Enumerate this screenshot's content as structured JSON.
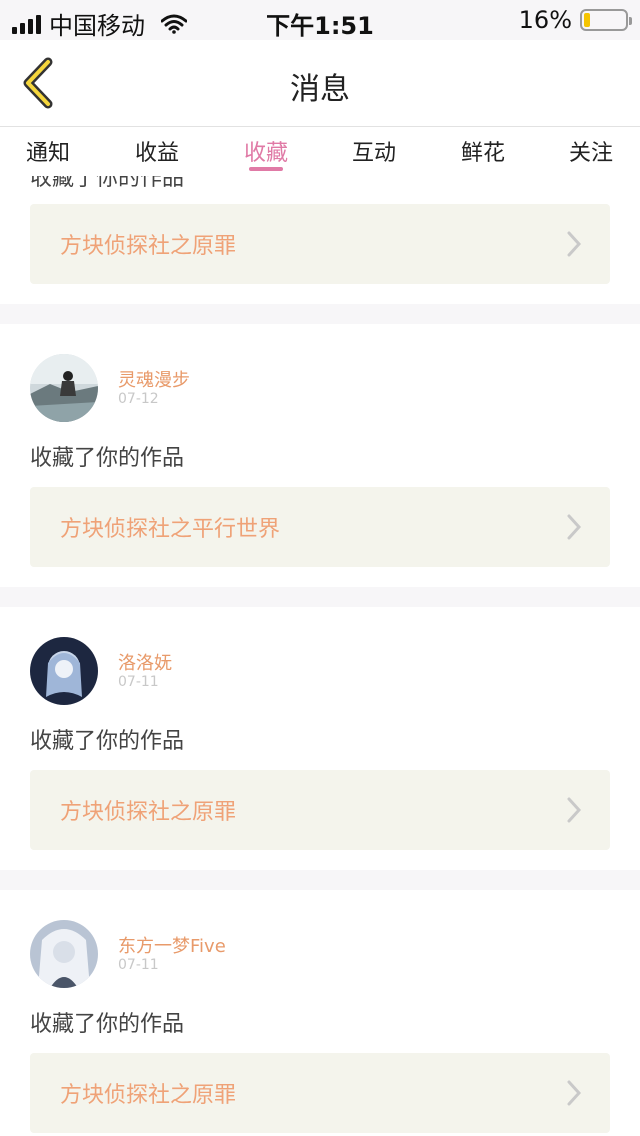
{
  "status_bar": {
    "carrier": "中国移动",
    "time": "下午1:51",
    "battery_text": "16%",
    "battery_level": 0.16,
    "battery_color": "#f5c400"
  },
  "nav": {
    "title": "消息",
    "back_icon": "chevron-left-icon"
  },
  "tabs": [
    {
      "label": "通知",
      "active": false
    },
    {
      "label": "收益",
      "active": false
    },
    {
      "label": "收藏",
      "active": true
    },
    {
      "label": "互动",
      "active": false
    },
    {
      "label": "鲜花",
      "active": false
    },
    {
      "label": "关注",
      "active": false
    }
  ],
  "colors": {
    "accent": "#e07aa6",
    "username": "#e89a6a",
    "work_title": "#efa277",
    "work_bg": "#f4f4ec"
  },
  "items": [
    {
      "action": "收藏了你的作品",
      "work_title": "方块侦探社之原罪"
    },
    {
      "user": "灵魂漫步",
      "date": "07-12",
      "action": "收藏了你的作品",
      "work_title": "方块侦探社之平行世界"
    },
    {
      "user": "洛洛妩",
      "date": "07-11",
      "action": "收藏了你的作品",
      "work_title": "方块侦探社之原罪"
    },
    {
      "user": "东方一梦Five",
      "date": "07-11",
      "action": "收藏了你的作品",
      "work_title": "方块侦探社之原罪"
    }
  ]
}
